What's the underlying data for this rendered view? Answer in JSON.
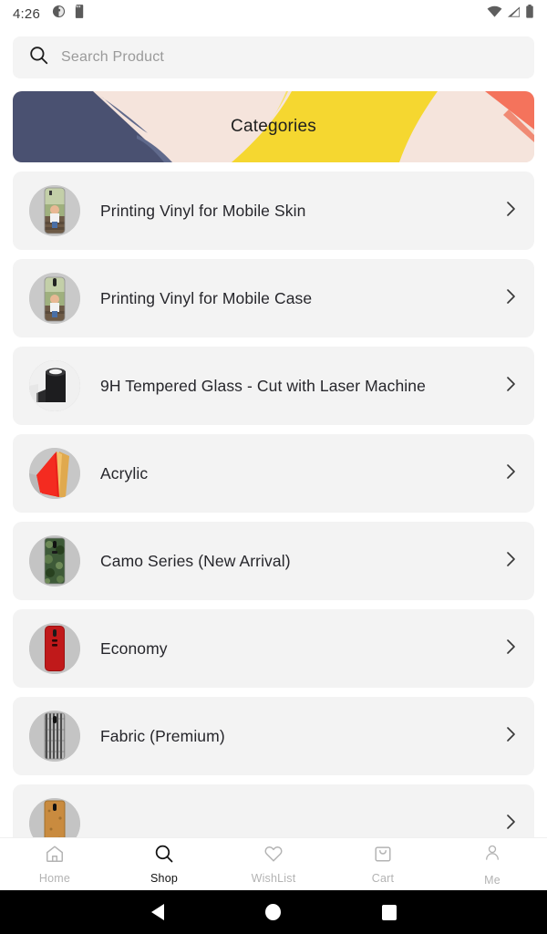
{
  "status_bar": {
    "time": "4:26",
    "left_icons": [
      "contrast-circle-icon",
      "sd-card-icon"
    ],
    "right_icons": [
      "wifi-icon",
      "cellular-signal-icon",
      "battery-icon"
    ]
  },
  "search": {
    "placeholder": "Search Product",
    "value": "",
    "icon": "search-icon"
  },
  "banner": {
    "title": "Categories",
    "colors": {
      "background": "#f5e4dc",
      "navy": "#4a5171",
      "yellow": "#f5d730",
      "coral": "#f4735c"
    }
  },
  "categories": [
    {
      "label": "Printing Vinyl for Mobile Skin",
      "thumb": "phone-skin-photo-thumb",
      "chevron": "chevron-right-icon"
    },
    {
      "label": "Printing Vinyl for Mobile Case",
      "thumb": "phone-case-photo-thumb",
      "chevron": "chevron-right-icon"
    },
    {
      "label": "9H Tempered Glass - Cut with Laser Machine",
      "thumb": "laser-machine-thumb",
      "chevron": "chevron-right-icon"
    },
    {
      "label": "Acrylic",
      "thumb": "acrylic-sheets-thumb",
      "chevron": "chevron-right-icon"
    },
    {
      "label": "Camo Series (New Arrival)",
      "thumb": "camo-skin-thumb",
      "chevron": "chevron-right-icon"
    },
    {
      "label": "Economy",
      "thumb": "red-texture-skin-thumb",
      "chevron": "chevron-right-icon"
    },
    {
      "label": "Fabric (Premium)",
      "thumb": "fabric-skin-thumb",
      "chevron": "chevron-right-icon"
    },
    {
      "label": "",
      "thumb": "cork-wood-skin-thumb",
      "chevron": "chevron-right-icon"
    }
  ],
  "bottom_nav": {
    "items": [
      {
        "label": "Home",
        "icon": "home-icon",
        "active": false
      },
      {
        "label": "Shop",
        "icon": "search-icon",
        "active": true
      },
      {
        "label": "WishList",
        "icon": "heart-icon",
        "active": false
      },
      {
        "label": "Cart",
        "icon": "shopping-bag-icon",
        "active": false
      },
      {
        "label": "Me",
        "icon": "person-icon",
        "active": false
      }
    ]
  },
  "android_nav": {
    "back": "back-triangle-icon",
    "home": "home-circle-icon",
    "recents": "recents-square-icon"
  }
}
